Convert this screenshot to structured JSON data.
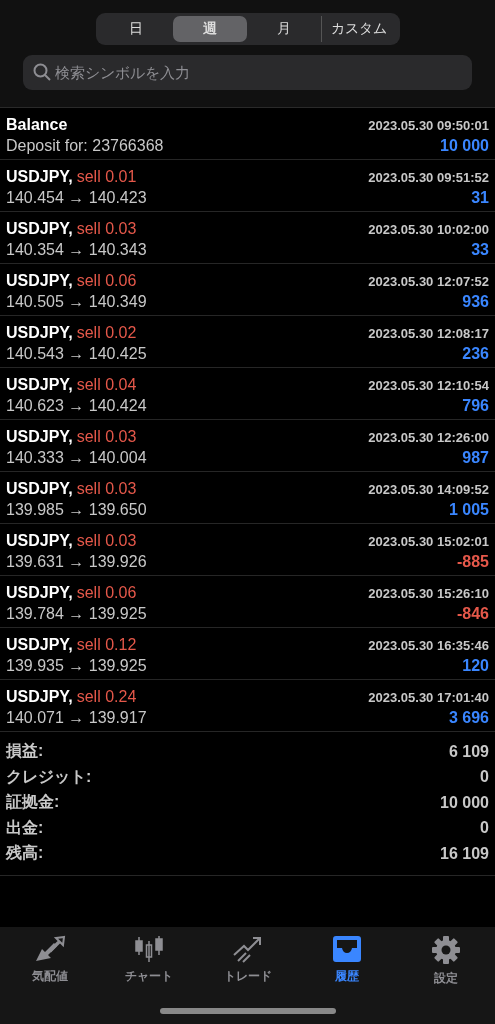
{
  "period_tabs": [
    {
      "label": "日",
      "selected": false
    },
    {
      "label": "週",
      "selected": true
    },
    {
      "label": "月",
      "selected": false
    },
    {
      "label": "カスタム",
      "selected": false
    }
  ],
  "search": {
    "placeholder": "検索シンボルを入力"
  },
  "rows": [
    {
      "kind": "balance",
      "title": "Balance",
      "time": "2023.05.30 09:50:01",
      "detail": "Deposit for: 23766368",
      "amount": "10 000",
      "loss": false
    },
    {
      "kind": "trade",
      "symbol": "USDJPY,",
      "side": "sell 0.01",
      "time": "2023.05.30 09:51:52",
      "prices": "140.454 → 140.423",
      "amount": "31",
      "loss": false
    },
    {
      "kind": "trade",
      "symbol": "USDJPY,",
      "side": "sell 0.03",
      "time": "2023.05.30 10:02:00",
      "prices": "140.354 → 140.343",
      "amount": "33",
      "loss": false
    },
    {
      "kind": "trade",
      "symbol": "USDJPY,",
      "side": "sell 0.06",
      "time": "2023.05.30 12:07:52",
      "prices": "140.505 → 140.349",
      "amount": "936",
      "loss": false
    },
    {
      "kind": "trade",
      "symbol": "USDJPY,",
      "side": "sell 0.02",
      "time": "2023.05.30 12:08:17",
      "prices": "140.543 → 140.425",
      "amount": "236",
      "loss": false
    },
    {
      "kind": "trade",
      "symbol": "USDJPY,",
      "side": "sell 0.04",
      "time": "2023.05.30 12:10:54",
      "prices": "140.623 → 140.424",
      "amount": "796",
      "loss": false
    },
    {
      "kind": "trade",
      "symbol": "USDJPY,",
      "side": "sell 0.03",
      "time": "2023.05.30 12:26:00",
      "prices": "140.333 → 140.004",
      "amount": "987",
      "loss": false
    },
    {
      "kind": "trade",
      "symbol": "USDJPY,",
      "side": "sell 0.03",
      "time": "2023.05.30 14:09:52",
      "prices": "139.985 → 139.650",
      "amount": "1 005",
      "loss": false
    },
    {
      "kind": "trade",
      "symbol": "USDJPY,",
      "side": "sell 0.03",
      "time": "2023.05.30 15:02:01",
      "prices": "139.631 → 139.926",
      "amount": "-885",
      "loss": true
    },
    {
      "kind": "trade",
      "symbol": "USDJPY,",
      "side": "sell 0.06",
      "time": "2023.05.30 15:26:10",
      "prices": "139.784 → 139.925",
      "amount": "-846",
      "loss": true
    },
    {
      "kind": "trade",
      "symbol": "USDJPY,",
      "side": "sell 0.12",
      "time": "2023.05.30 16:35:46",
      "prices": "139.935 → 139.925",
      "amount": "120",
      "loss": false
    },
    {
      "kind": "trade",
      "symbol": "USDJPY,",
      "side": "sell 0.24",
      "time": "2023.05.30 17:01:40",
      "prices": "140.071 → 139.917",
      "amount": "3 696",
      "loss": false
    }
  ],
  "summary": [
    {
      "label": "損益:",
      "value": "6 109"
    },
    {
      "label": "クレジット:",
      "value": "0"
    },
    {
      "label": "証拠金:",
      "value": "10 000"
    },
    {
      "label": "出金:",
      "value": "0"
    },
    {
      "label": "残高:",
      "value": "16 109"
    }
  ],
  "tab_bar": [
    {
      "label": "気配値",
      "selected": false
    },
    {
      "label": "チャート",
      "selected": false
    },
    {
      "label": "トレード",
      "selected": false
    },
    {
      "label": "履歴",
      "selected": true
    },
    {
      "label": "設定",
      "selected": false
    }
  ]
}
